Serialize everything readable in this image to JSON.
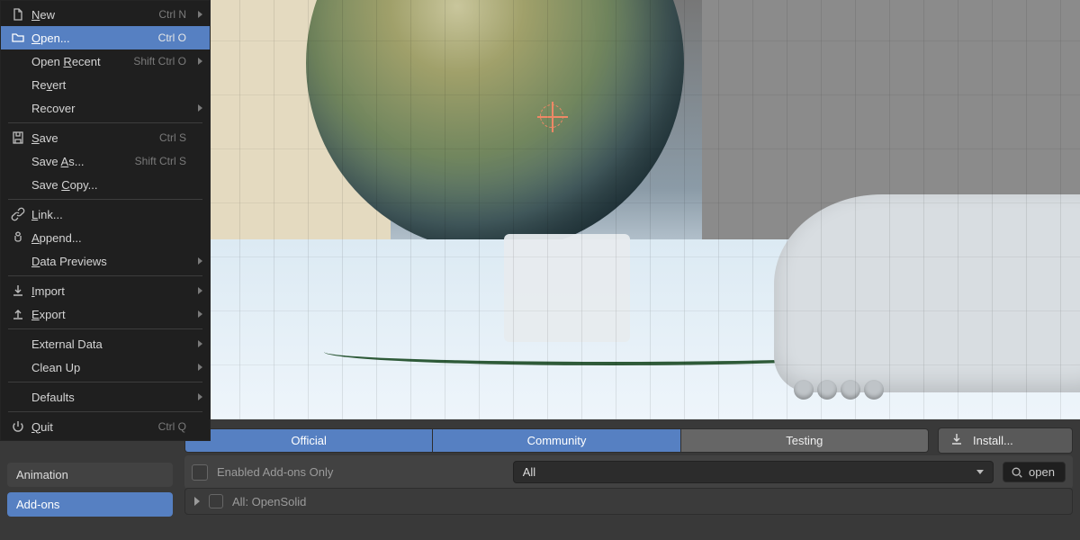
{
  "file_menu": {
    "items": [
      {
        "icon": "file-new-icon",
        "label": "New",
        "shortcut": "Ctrl N",
        "submenu": true,
        "highlighted": false
      },
      {
        "icon": "folder-icon",
        "label": "Open...",
        "shortcut": "Ctrl O",
        "submenu": false,
        "highlighted": true
      },
      {
        "icon": "",
        "label": "Open Recent",
        "shortcut": "Shift Ctrl O",
        "submenu": true,
        "highlighted": false
      },
      {
        "icon": "",
        "label": "Revert",
        "shortcut": "",
        "submenu": false,
        "highlighted": false
      },
      {
        "icon": "",
        "label": "Recover",
        "shortcut": "",
        "submenu": true,
        "highlighted": false
      },
      {
        "separator": true
      },
      {
        "icon": "save-icon",
        "label": "Save",
        "shortcut": "Ctrl S",
        "submenu": false,
        "highlighted": false
      },
      {
        "icon": "",
        "label": "Save As...",
        "shortcut": "Shift Ctrl S",
        "submenu": false,
        "highlighted": false
      },
      {
        "icon": "",
        "label": "Save Copy...",
        "shortcut": "",
        "submenu": false,
        "highlighted": false
      },
      {
        "separator": true
      },
      {
        "icon": "link-icon",
        "label": "Link...",
        "shortcut": "",
        "submenu": false,
        "highlighted": false
      },
      {
        "icon": "append-icon",
        "label": "Append...",
        "shortcut": "",
        "submenu": false,
        "highlighted": false
      },
      {
        "icon": "",
        "label": "Data Previews",
        "shortcut": "",
        "submenu": true,
        "highlighted": false
      },
      {
        "separator": true
      },
      {
        "icon": "import-icon",
        "label": "Import",
        "shortcut": "",
        "submenu": true,
        "highlighted": false
      },
      {
        "icon": "export-icon",
        "label": "Export",
        "shortcut": "",
        "submenu": true,
        "highlighted": false
      },
      {
        "separator": true
      },
      {
        "icon": "",
        "label": "External Data",
        "shortcut": "",
        "submenu": true,
        "highlighted": false
      },
      {
        "icon": "",
        "label": "Clean Up",
        "shortcut": "",
        "submenu": true,
        "highlighted": false
      },
      {
        "separator": true
      },
      {
        "icon": "",
        "label": "Defaults",
        "shortcut": "",
        "submenu": true,
        "highlighted": false
      },
      {
        "separator": true
      },
      {
        "icon": "power-icon",
        "label": "Quit",
        "shortcut": "Ctrl Q",
        "submenu": false,
        "highlighted": false
      }
    ]
  },
  "source_tabs": {
    "official": "Official",
    "community": "Community",
    "testing": "Testing",
    "active": [
      "official",
      "community"
    ]
  },
  "install_button": {
    "label": "Install...",
    "icon": "download-icon"
  },
  "filter": {
    "enabled_only_label": "Enabled Add-ons Only",
    "enabled_only_checked": false,
    "category_selected": "All",
    "search_icon": "search-icon",
    "search_value": "open"
  },
  "addon_list": [
    {
      "enabled": false,
      "label": "All: OpenSolid"
    }
  ],
  "sidebar": {
    "items": [
      {
        "label": "Animation",
        "active": false
      },
      {
        "label": "Add-ons",
        "active": true
      }
    ]
  }
}
